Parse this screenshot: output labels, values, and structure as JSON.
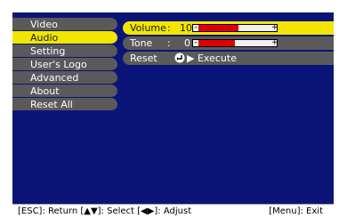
{
  "menu": {
    "items": [
      {
        "label": "Video",
        "selected": false
      },
      {
        "label": "Audio",
        "selected": true
      },
      {
        "label": "Setting",
        "selected": false
      },
      {
        "label": "User's Logo",
        "selected": false
      },
      {
        "label": "Advanced",
        "selected": false
      },
      {
        "label": "About",
        "selected": false
      },
      {
        "label": "Reset All",
        "selected": false
      }
    ]
  },
  "panel": {
    "volume": {
      "label": "Volume",
      "colon": ":",
      "value": "10",
      "level_fraction": 0.55,
      "minus": "-",
      "plus": "+"
    },
    "tone": {
      "label": "Tone",
      "colon": ":",
      "value": "0",
      "level_fraction": 0.5,
      "minus": "-",
      "plus": "+"
    },
    "reset": {
      "label": "Reset",
      "action": "Execute"
    }
  },
  "status": {
    "left": "[ESC]: Return [▲▼]: Select [◀▶]: Adjust",
    "right": "[Menu]: Exit"
  },
  "colors": {
    "background": "#0b1578",
    "highlight": "#f2e600",
    "item": "#5a5a5a",
    "bar_fill": "#e00000"
  }
}
